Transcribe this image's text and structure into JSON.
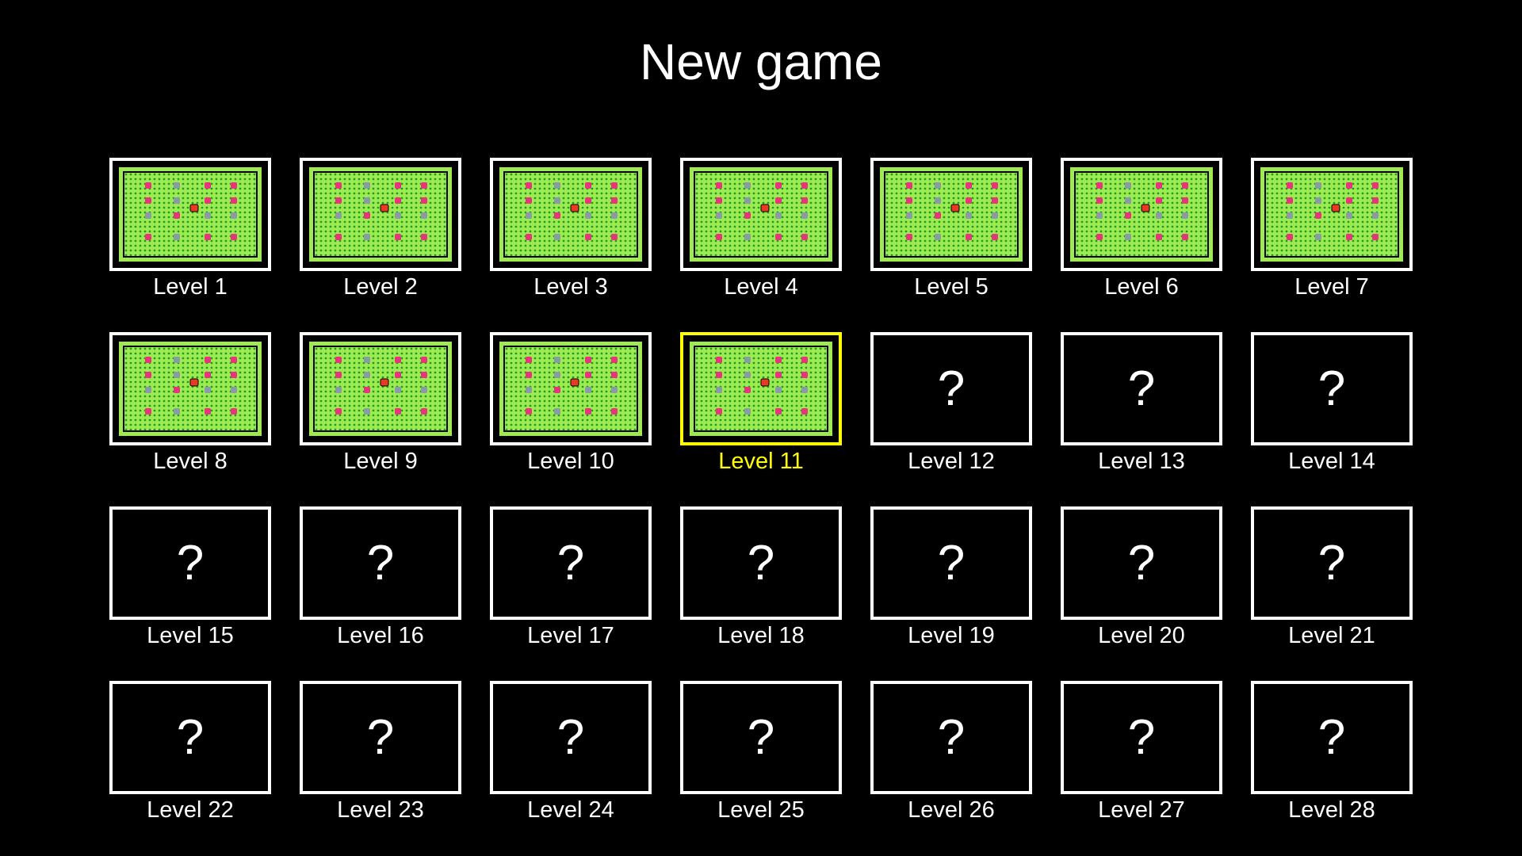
{
  "title": "New game",
  "selected_level": 11,
  "colors": {
    "background": "#000000",
    "text": "#ffffff",
    "selected": "#ffff00",
    "board_green": "#9eea52",
    "board_dot": "#1f9e1f",
    "board_border": "#000000",
    "target_pink": "#e8347a",
    "crate_gray": "#8a9aa6",
    "player_red": "#e83a1c"
  },
  "locked_symbol": "?",
  "levels": [
    {
      "label": "Level 1",
      "unlocked": true
    },
    {
      "label": "Level 2",
      "unlocked": true
    },
    {
      "label": "Level 3",
      "unlocked": true
    },
    {
      "label": "Level 4",
      "unlocked": true
    },
    {
      "label": "Level 5",
      "unlocked": true
    },
    {
      "label": "Level 6",
      "unlocked": true
    },
    {
      "label": "Level 7",
      "unlocked": true
    },
    {
      "label": "Level 8",
      "unlocked": true
    },
    {
      "label": "Level 9",
      "unlocked": true
    },
    {
      "label": "Level 10",
      "unlocked": true
    },
    {
      "label": "Level 11",
      "unlocked": true
    },
    {
      "label": "Level 12",
      "unlocked": false
    },
    {
      "label": "Level 13",
      "unlocked": false
    },
    {
      "label": "Level 14",
      "unlocked": false
    },
    {
      "label": "Level 15",
      "unlocked": false
    },
    {
      "label": "Level 16",
      "unlocked": false
    },
    {
      "label": "Level 17",
      "unlocked": false
    },
    {
      "label": "Level 18",
      "unlocked": false
    },
    {
      "label": "Level 19",
      "unlocked": false
    },
    {
      "label": "Level 20",
      "unlocked": false
    },
    {
      "label": "Level 21",
      "unlocked": false
    },
    {
      "label": "Level 22",
      "unlocked": false
    },
    {
      "label": "Level 23",
      "unlocked": false
    },
    {
      "label": "Level 24",
      "unlocked": false
    },
    {
      "label": "Level 25",
      "unlocked": false
    },
    {
      "label": "Level 26",
      "unlocked": false
    },
    {
      "label": "Level 27",
      "unlocked": false
    },
    {
      "label": "Level 28",
      "unlocked": false
    }
  ]
}
